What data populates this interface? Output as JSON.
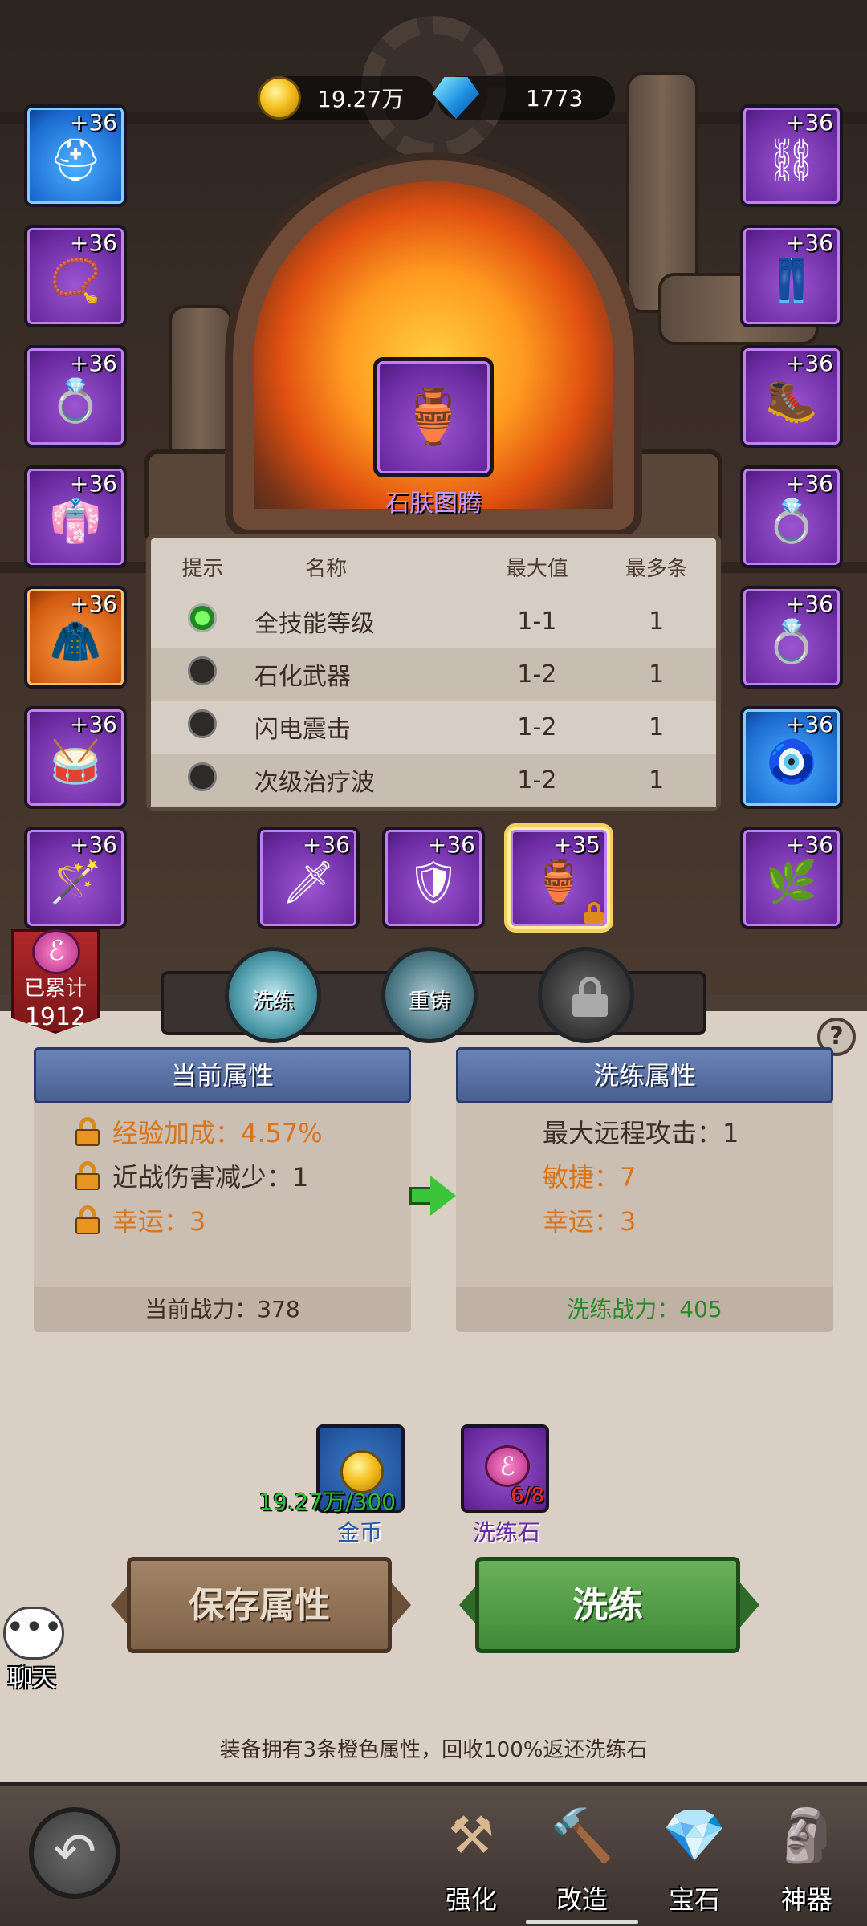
{
  "resources": {
    "gold": "19.27万",
    "diamonds": "1773"
  },
  "equipment_left": [
    {
      "level": "+36",
      "icon": "hood-icon",
      "glyph": "⛑"
    },
    {
      "level": "+36",
      "icon": "necklace-icon",
      "glyph": "📿"
    },
    {
      "level": "+36",
      "icon": "ring-icon",
      "glyph": "💍"
    },
    {
      "level": "+36",
      "icon": "robe-icon",
      "glyph": "👘"
    },
    {
      "level": "+36",
      "icon": "cape-icon",
      "glyph": "🧥"
    },
    {
      "level": "+36",
      "icon": "bracer-icon",
      "glyph": "🥁"
    },
    {
      "level": "+36",
      "icon": "staff-icon",
      "glyph": "🪄"
    }
  ],
  "equipment_right": [
    {
      "level": "+36",
      "icon": "chain-icon",
      "glyph": "⛓"
    },
    {
      "level": "+36",
      "icon": "pants-icon",
      "glyph": "👖"
    },
    {
      "level": "+36",
      "icon": "boots-icon",
      "glyph": "🥾"
    },
    {
      "level": "+36",
      "icon": "gold-ring-icon",
      "glyph": "💍"
    },
    {
      "level": "+36",
      "icon": "gold-ring-icon",
      "glyph": "💍"
    },
    {
      "level": "+36",
      "icon": "amulet-icon",
      "glyph": "🧿"
    },
    {
      "level": "+36",
      "icon": "leaf-amulet-icon",
      "glyph": "🌿"
    }
  ],
  "equipment_bottom": [
    {
      "level": "+36",
      "icon": "dagger-icon",
      "glyph": "🗡"
    },
    {
      "level": "+36",
      "icon": "shield-icon",
      "glyph": "🛡"
    },
    {
      "level": "+35",
      "icon": "totem-icon",
      "glyph": "🏺"
    }
  ],
  "selected_item": {
    "name": "石肤图腾",
    "glyph": "🏺"
  },
  "affix_table": {
    "headers": [
      "提示",
      "名称",
      "最大值",
      "最多条"
    ],
    "rows": [
      {
        "name": "全技能等级",
        "max": "1-1",
        "count": "1",
        "active": true
      },
      {
        "name": "石化武器",
        "max": "1-2",
        "count": "1",
        "active": false
      },
      {
        "name": "闪电震击",
        "max": "1-2",
        "count": "1",
        "active": false
      },
      {
        "name": "次级治疗波",
        "max": "1-2",
        "count": "1",
        "active": false
      }
    ]
  },
  "accumulated": {
    "label": "已累计",
    "value": "1912"
  },
  "tabs": {
    "wash": "洗练",
    "recast": "重铸"
  },
  "current_attrs": {
    "title": "当前属性",
    "lines": [
      {
        "text": "经验加成：4.57%",
        "color": "#d8741a"
      },
      {
        "text": "近战伤害减少：1",
        "color": "#3a2e26"
      },
      {
        "text": "幸运：3",
        "color": "#d8741a"
      }
    ],
    "power": "当前战力：378"
  },
  "wash_attrs": {
    "title": "洗练属性",
    "lines": [
      {
        "text": "最大远程攻击：1",
        "color": "#3a2e26"
      },
      {
        "text": "敏捷：7",
        "color": "#d8741a"
      },
      {
        "text": "幸运：3",
        "color": "#d8741a"
      }
    ],
    "power": "洗练战力：405"
  },
  "costs": {
    "gold_amount": "19.27万/300",
    "gold_label": "金币",
    "stone_amount": "6/8",
    "stone_label": "洗练石"
  },
  "buttons": {
    "save": "保存属性",
    "wash": "洗练"
  },
  "chat": "聊天",
  "notice": "装备拥有3条橙色属性，回收100%返还洗练石",
  "bottom_nav": [
    {
      "label": "强化",
      "icon": "anvil-icon",
      "glyph": "⚒"
    },
    {
      "label": "改造",
      "icon": "hammer-icon",
      "glyph": "🔨"
    },
    {
      "label": "宝石",
      "icon": "crystal-icon",
      "glyph": "💎"
    },
    {
      "label": "神器",
      "icon": "artifact-icon",
      "glyph": "🗿"
    }
  ],
  "colors": {
    "purple_rarity": "#6a2aa0",
    "blue_rarity": "#1c6ad0",
    "orange_rarity": "#d05a10",
    "accent_green": "#3f8a38",
    "header_blue": "#4a5f92"
  }
}
